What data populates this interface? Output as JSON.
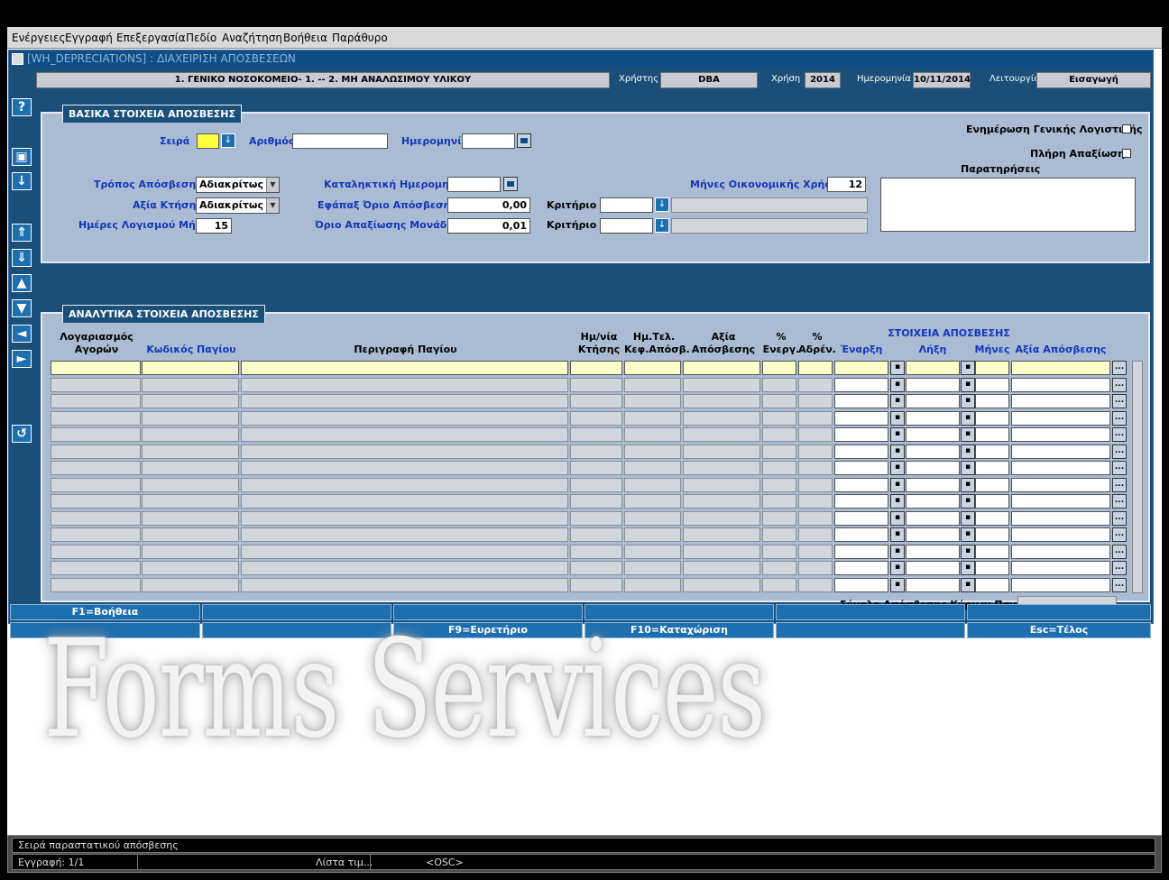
{
  "menu": [
    "Ενέργειες",
    "Εγγραφή",
    "Επεξεργασία",
    "Πεδίο",
    "Αναζήτηση",
    "Βοήθεια",
    "Παράθυρο"
  ],
  "window": {
    "title": "[WH_DEPRECIATIONS]  :  ΔΙΑΧΕΙΡΙΣΗ ΑΠΟΣΒΕΣΕΩΝ"
  },
  "context": {
    "org": "1. ΓΕΝΙΚΟ ΝΟΣΟΚΟΜΕΙΟ- 1. -- 2. ΜΗ ΑΝΑΛΩΣΙΜΟΥ ΥΛΙΚΟΥ",
    "user_label": "Χρήστης",
    "user": "DBA",
    "year_label": "Χρήση",
    "year": "2014",
    "date_label": "Ημερομηνία",
    "date": "10/11/2014",
    "mode_label": "Λειτουργία",
    "mode": "Εισαγωγή"
  },
  "basic": {
    "title": "ΒΑΣΙΚΑ ΣΤΟΙΧΕΙΑ ΑΠΟΣΒΕΣΗΣ",
    "seira": "Σειρά",
    "arithmos": "Αριθμός",
    "hmerominia": "Ημερομηνία",
    "tropos": "Τρόπος Απόσβεσης",
    "tropos_val": "Αδιακρίτως",
    "axia": "Αξία Κτήσης",
    "axia_val": "Αδιακρίτως",
    "imeres": "Ημέρες Λογισμού Μήνα",
    "imeres_val": "15",
    "katal": "Καταληκτική Ημερομηνία",
    "efapax": "Εφάπαξ Όριο Απόσβεσης",
    "efapax_val": "0,00",
    "orio": "Όριο Απαξίωσης Μονάδας",
    "orio_val": "0,01",
    "krit1": "Κριτήριο 1",
    "krit2": "Κριτήριο 2",
    "mines": "Μήνες Οικονομικής Χρήσης",
    "mines_val": "12",
    "enimerosi": "Ενημέρωση Γενικής Λογιστικής",
    "pliri": "Πλήρη Απαξίωση",
    "paratiriseis": "Παρατηρήσεις"
  },
  "detail": {
    "title": "ΑΝΑΛΥΤΙΚΑ ΣΤΟΙΧΕΙΑ ΑΠΟΣΒΕΣΗΣ",
    "group": "ΣΤΟΙΧΕΙΑ ΑΠΟΣΒΕΣΗΣ",
    "h_log1": "Λογαριασμός",
    "h_log2": "Αγορών",
    "h_kod": "Κωδικός Παγίου",
    "h_per": "Περιγραφή Παγίου",
    "h_hm1": "Ημ/νία",
    "h_hm2": "Κτήσης",
    "h_tel1": "Ημ.Τελ.",
    "h_tel2": "Κεφ.Απόσβ.",
    "h_ax1": "Αξία",
    "h_ax2": "Απόσβεσης",
    "h_en1": "%",
    "h_en2": "Ενεργ.",
    "h_ad1": "%",
    "h_ad2": "Αδρέν.",
    "h_enarxi": "Έναρξη",
    "h_lixi": "Λήξη",
    "h_mines": "Μήνες",
    "h_axiaap": "Αξία Απόσβεσης",
    "total": "Σύνολο Απόσβεσης Κύριων Παγίων"
  },
  "fkeys": {
    "f1": "F1=Βοήθεια",
    "f9": "F9=Ευρετήριο",
    "f10": "F10=Καταχώριση",
    "esc": "Esc=Τέλος"
  },
  "brand": "Forms Services",
  "status": {
    "hint": "Σειρά παραστατικού απόσβεσης",
    "record": "Εγγραφή: 1/1",
    "lov": "Λίστα τιμ...",
    "osc": "<OSC>"
  }
}
